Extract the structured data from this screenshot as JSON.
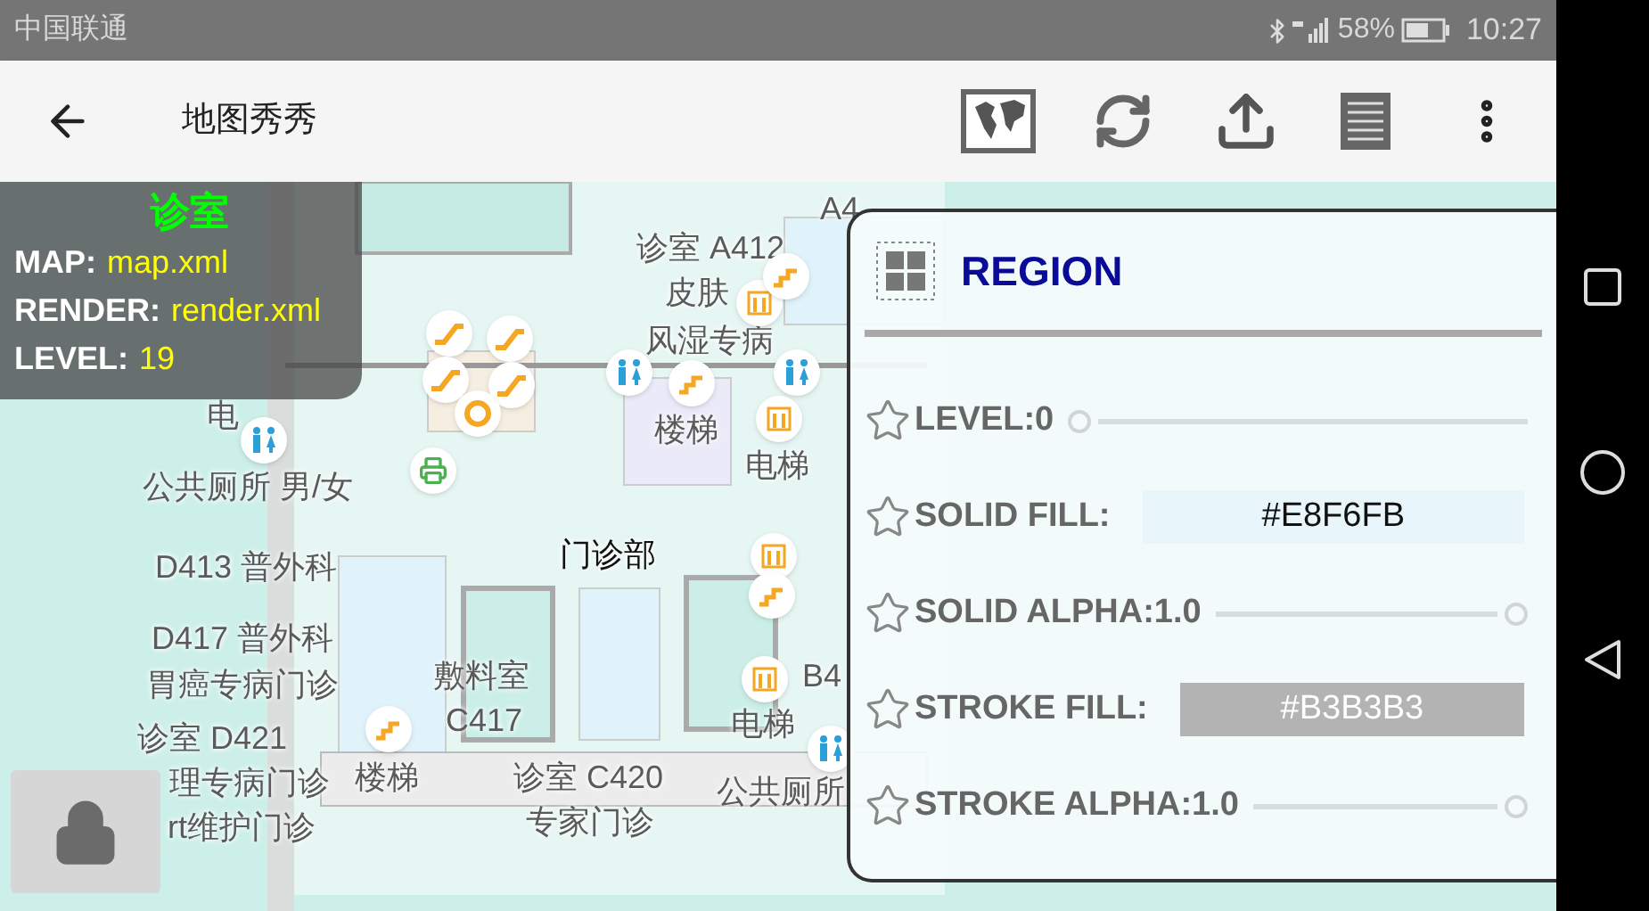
{
  "status_bar": {
    "carrier": "中国联通",
    "battery": "58%",
    "time": "10:27"
  },
  "app_bar": {
    "title": "地图秀秀"
  },
  "info_overlay": {
    "title": "诊室",
    "lines": [
      {
        "label": "MAP:",
        "value": "map.xml"
      },
      {
        "label": "RENDER:",
        "value": "render.xml"
      },
      {
        "label": "LEVEL:",
        "value": "19"
      }
    ]
  },
  "map_labels": [
    {
      "kind": "room",
      "text": "A4"
    },
    {
      "kind": "room",
      "text": "诊室 A412"
    },
    {
      "kind": "room",
      "text": "皮肤"
    },
    {
      "kind": "room",
      "text": "风湿专病"
    },
    {
      "kind": "room",
      "text": "电"
    },
    {
      "kind": "room",
      "text": "楼梯"
    },
    {
      "kind": "room",
      "text": "电梯"
    },
    {
      "kind": "room",
      "text": "公共厕所 男/女"
    },
    {
      "kind": "zone",
      "text": "门诊部"
    },
    {
      "kind": "room",
      "text": "D413 普外科"
    },
    {
      "kind": "room",
      "text": "D417 普外科"
    },
    {
      "kind": "room",
      "text": "胃癌专病门诊"
    },
    {
      "kind": "room",
      "text": "敷料室"
    },
    {
      "kind": "room",
      "text": "C417"
    },
    {
      "kind": "room",
      "text": "B4"
    },
    {
      "kind": "room",
      "text": "电梯"
    },
    {
      "kind": "room",
      "text": "诊室 D421"
    },
    {
      "kind": "room",
      "text": "理专病门诊"
    },
    {
      "kind": "room",
      "text": "楼梯"
    },
    {
      "kind": "room",
      "text": "诊室 C420"
    },
    {
      "kind": "room",
      "text": "公共厕所"
    },
    {
      "kind": "room",
      "text": "rt维护门诊"
    },
    {
      "kind": "room",
      "text": "专家门诊"
    }
  ],
  "map_pins": [
    {
      "kind": "escalator"
    },
    {
      "kind": "escalator"
    },
    {
      "kind": "escalator"
    },
    {
      "kind": "escalator"
    },
    {
      "kind": "person"
    },
    {
      "kind": "toilet"
    },
    {
      "kind": "printer"
    },
    {
      "kind": "toilet"
    },
    {
      "kind": "stairs"
    },
    {
      "kind": "toilet"
    },
    {
      "kind": "elevator"
    },
    {
      "kind": "elevator"
    },
    {
      "kind": "stairs"
    },
    {
      "kind": "elevator"
    },
    {
      "kind": "stairs"
    },
    {
      "kind": "elevator"
    },
    {
      "kind": "stairs"
    },
    {
      "kind": "toilet"
    }
  ],
  "region_panel": {
    "title": "REGION",
    "rows": [
      {
        "kind": "slider",
        "label": "LEVEL:0",
        "level": 0
      },
      {
        "kind": "color",
        "label": "SOLID FILL:",
        "value": "#E8F6FB"
      },
      {
        "kind": "slider",
        "label": "SOLID ALPHA:1.0",
        "level": 1
      },
      {
        "kind": "color",
        "label": "STROKE FILL:",
        "value": "#B3B3B3"
      },
      {
        "kind": "slider",
        "label": "STROKE ALPHA:1.0",
        "level": 1
      }
    ]
  }
}
